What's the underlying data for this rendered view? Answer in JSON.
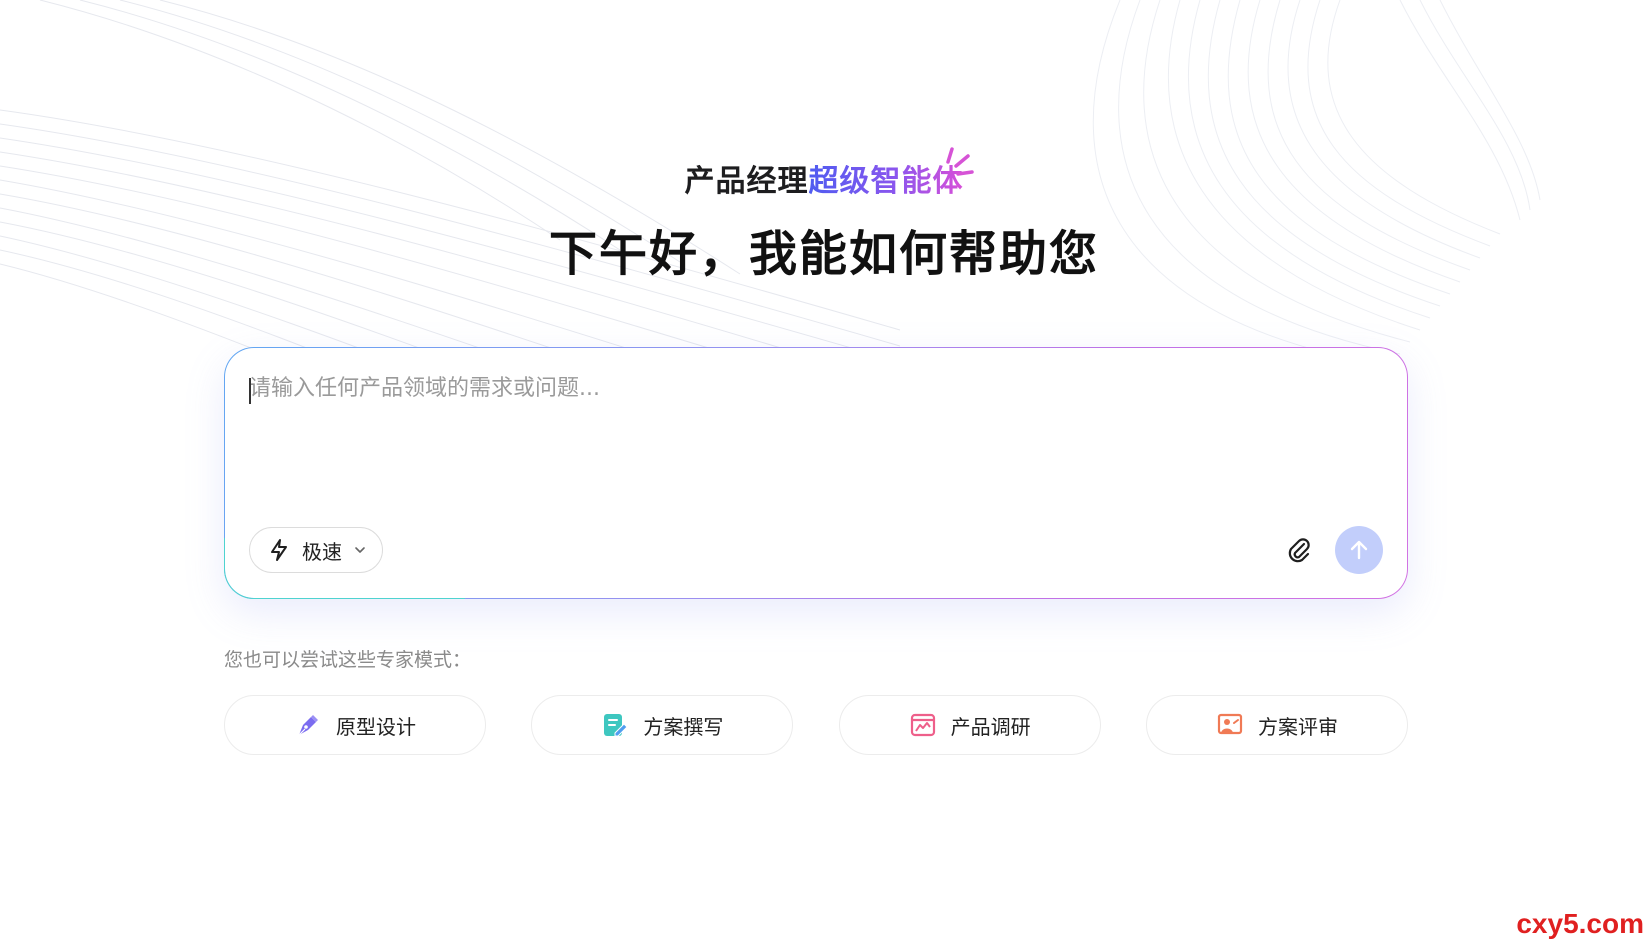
{
  "header": {
    "subtitle_plain": "产品经理",
    "subtitle_accent": "超级智能体",
    "headline": "下午好，我能如何帮助您"
  },
  "composer": {
    "placeholder": "请输入任何产品领域的需求或问题...",
    "value": "",
    "mode_label": "极速",
    "mode_icon": "lightning-icon",
    "attach_icon": "paperclip-icon",
    "send_icon": "arrow-up-icon"
  },
  "experts": {
    "hint": "您也可以尝试这些专家模式：",
    "items": [
      {
        "label": "原型设计",
        "icon": "pen-nib-icon",
        "color": "#7b6cf0"
      },
      {
        "label": "方案撰写",
        "icon": "document-edit-icon",
        "color": "#3ec7c0"
      },
      {
        "label": "产品调研",
        "icon": "browser-chart-icon",
        "color": "#ee5f8a"
      },
      {
        "label": "方案评审",
        "icon": "presentation-person-icon",
        "color": "#f07a55"
      }
    ]
  },
  "watermark": "cxy5.com",
  "colors": {
    "accent_start": "#4f5cf0",
    "accent_end": "#d84fd8",
    "send_button": "#c2cefb"
  }
}
